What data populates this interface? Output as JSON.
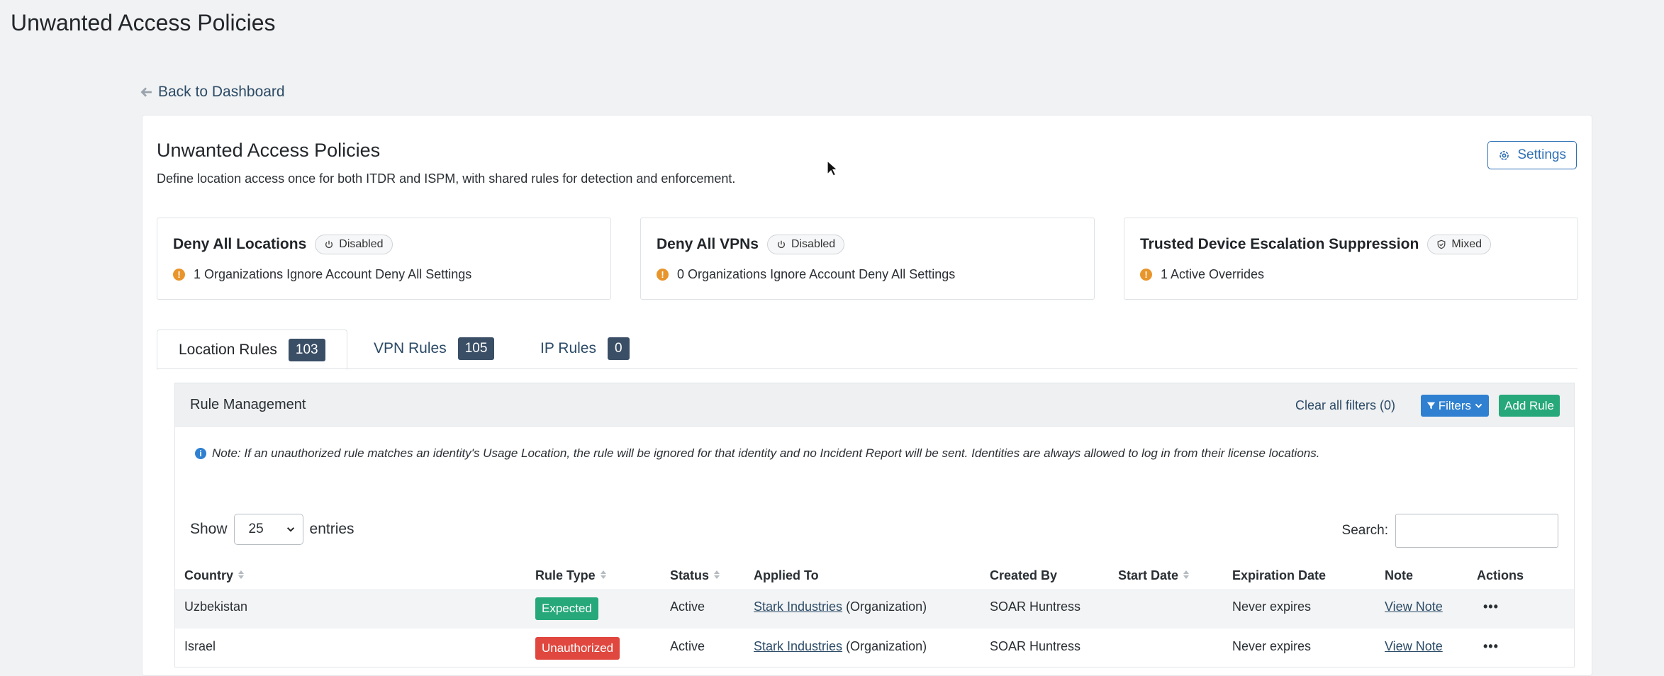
{
  "page": {
    "title": "Unwanted Access Policies"
  },
  "back_link": {
    "label": "Back to Dashboard"
  },
  "card": {
    "title": "Unwanted Access Policies",
    "description": "Define location access once for both ITDR and ISPM, with shared rules for detection and enforcement.",
    "settings_label": "Settings"
  },
  "stats": [
    {
      "title": "Deny All Locations",
      "pill": "Disabled",
      "pill_icon": "power-icon",
      "sub": "1 Organizations Ignore Account Deny All Settings"
    },
    {
      "title": "Deny All VPNs",
      "pill": "Disabled",
      "pill_icon": "power-icon",
      "sub": "0 Organizations Ignore Account Deny All Settings"
    },
    {
      "title": "Trusted Device Escalation Suppression",
      "pill": "Mixed",
      "pill_icon": "shield-check-icon",
      "sub": "1 Active Overrides"
    }
  ],
  "tabs": [
    {
      "label": "Location Rules",
      "count": "103",
      "active": true
    },
    {
      "label": "VPN Rules",
      "count": "105",
      "active": false
    },
    {
      "label": "IP Rules",
      "count": "0",
      "active": false
    }
  ],
  "panel": {
    "title": "Rule Management",
    "clear_filters": "Clear all filters (0)",
    "filters_label": "Filters",
    "add_rule_label": "Add Rule",
    "note": "Note: If an unauthorized rule matches an identity's Usage Location, the rule will be ignored for that identity and no Incident Report will be sent. Identities are always allowed to log in from their license locations.",
    "show_label": "Show",
    "entries_value": "25",
    "entries_label": "entries",
    "search_label": "Search:",
    "search_value": ""
  },
  "table": {
    "columns": [
      "Country",
      "Rule Type",
      "Status",
      "Applied To",
      "Created By",
      "Start Date",
      "Expiration Date",
      "Note",
      "Actions"
    ],
    "rows": [
      {
        "country": "Uzbekistan",
        "rule_type": "Expected",
        "status": "Active",
        "applied_link": "Stark Industries",
        "applied_suffix": " (Organization)",
        "created_by": "SOAR Huntress",
        "start_date": "",
        "expiration": "Never expires",
        "note": "View Note",
        "actions": "•••"
      },
      {
        "country": "Israel",
        "rule_type": "Unauthorized",
        "status": "Active",
        "applied_link": "Stark Industries",
        "applied_suffix": " (Organization)",
        "created_by": "SOAR Huntress",
        "start_date": "",
        "expiration": "Never expires",
        "note": "View Note",
        "actions": "•••"
      }
    ]
  },
  "colors": {
    "accent": "#2f80d1",
    "success": "#26a87a",
    "danger": "#e0473e",
    "warning": "#e8952c",
    "badge_dark": "#3a4e66"
  }
}
